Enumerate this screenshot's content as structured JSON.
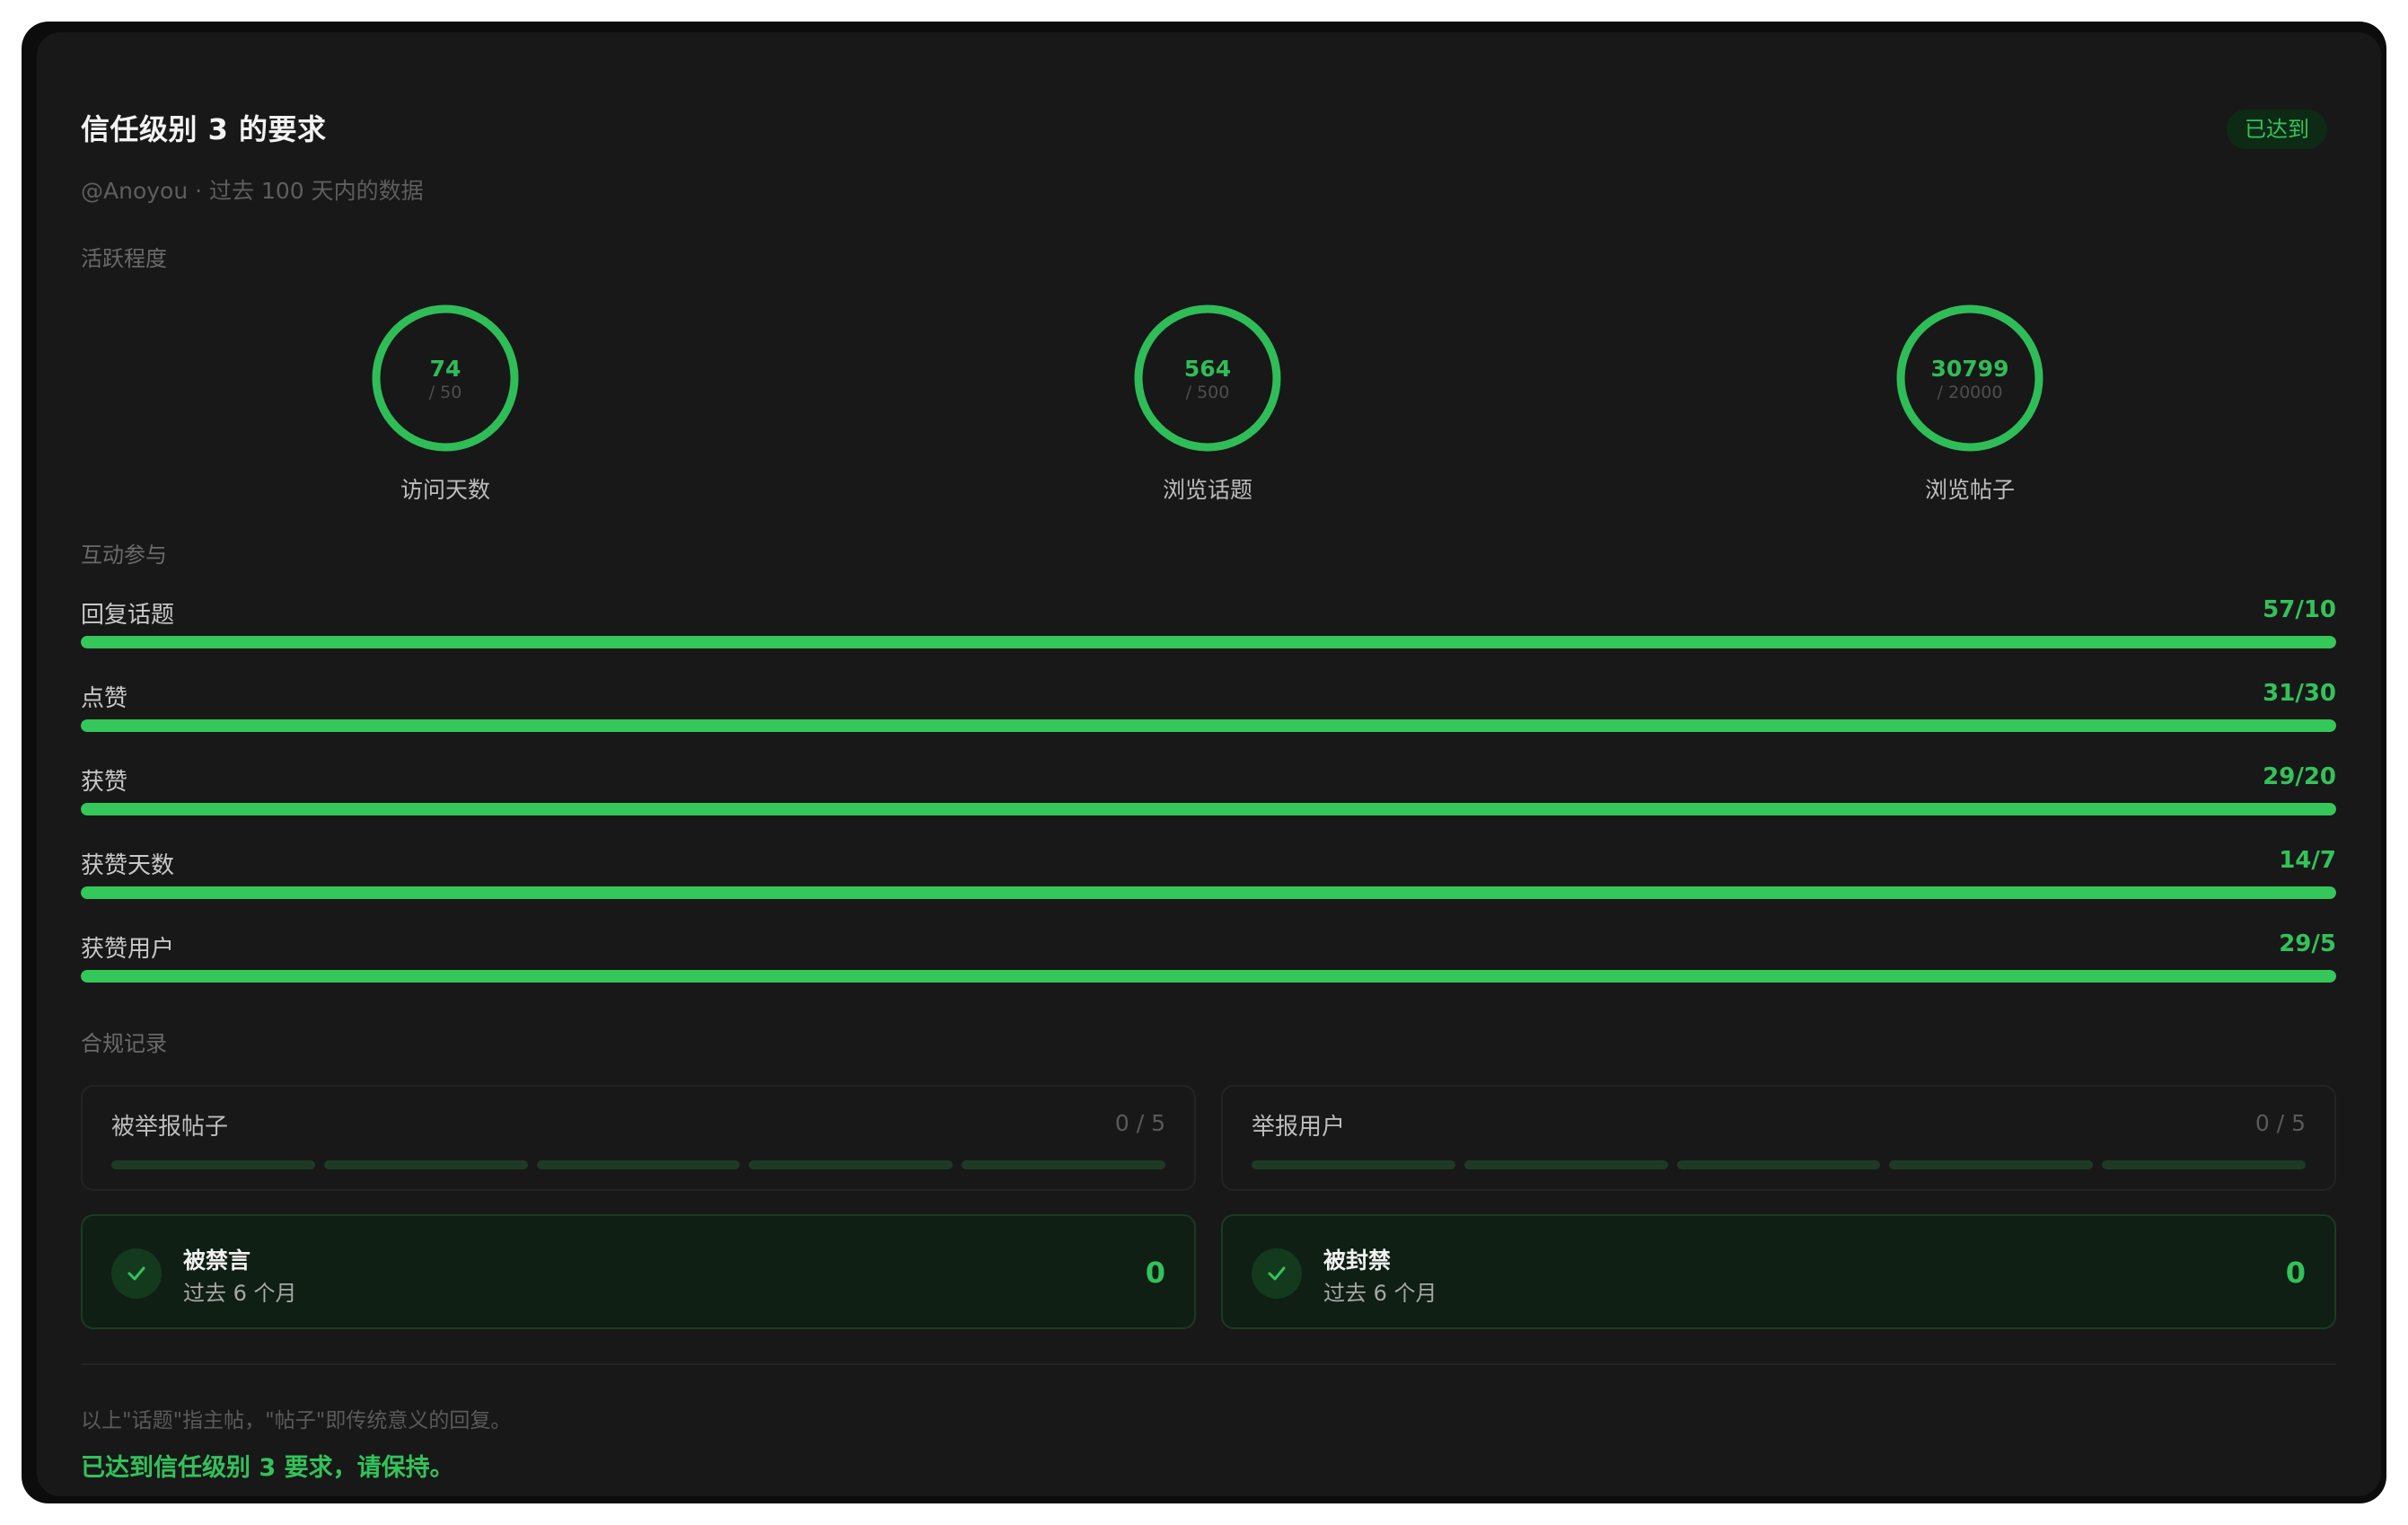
{
  "header": {
    "title": "信任级别 3 的要求",
    "status": "已达到",
    "subtitle": "@Anoyou · 过去 100 天内的数据"
  },
  "activity": {
    "label": "活跃程度",
    "rings": [
      {
        "value": "74",
        "target": "/ 50",
        "label": "访问天数",
        "progress": 1.0
      },
      {
        "value": "564",
        "target": "/ 500",
        "label": "浏览话题",
        "progress": 1.0
      },
      {
        "value": "30799",
        "target": "/ 20000",
        "label": "浏览帖子",
        "progress": 1.0
      }
    ]
  },
  "engagement": {
    "label": "互动参与",
    "bars": [
      {
        "label": "回复话题",
        "value": "57/10",
        "progress": 1.0
      },
      {
        "label": "点赞",
        "value": "31/30",
        "progress": 1.0
      },
      {
        "label": "获赞",
        "value": "29/20",
        "progress": 1.0
      },
      {
        "label": "获赞天数",
        "value": "14/7",
        "progress": 1.0
      },
      {
        "label": "获赞用户",
        "value": "29/5",
        "progress": 1.0
      }
    ]
  },
  "compliance": {
    "label": "合规记录",
    "reports": [
      {
        "title": "被举报帖子",
        "count": "0 / 5",
        "filled": 0
      },
      {
        "title": "举报用户",
        "count": "0 / 5",
        "filled": 0
      }
    ],
    "bans": [
      {
        "title": "被禁言",
        "subtitle": "过去 6 个月",
        "count": "0"
      },
      {
        "title": "被封禁",
        "subtitle": "过去 6 个月",
        "count": "0"
      }
    ]
  },
  "footer": {
    "note": "以上\"话题\"指主帖，\"帖子\"即传统意义的回复。",
    "message": "已达到信任级别 3 要求，请保持。"
  },
  "colors": {
    "accent": "#34c759",
    "background": "#181818",
    "track": "#1f3a25"
  }
}
